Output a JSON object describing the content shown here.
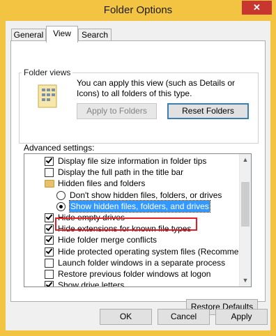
{
  "window": {
    "title": "Folder Options",
    "close_label": "✕"
  },
  "tabs": [
    {
      "label": "General"
    },
    {
      "label": "View"
    },
    {
      "label": "Search"
    }
  ],
  "folder_views": {
    "group_label": "Folder views",
    "description": "You can apply this view (such as Details or Icons) to all folders of this type.",
    "apply_label": "Apply to Folders",
    "reset_label": "Reset Folders"
  },
  "advanced": {
    "label": "Advanced settings:",
    "items": [
      {
        "type": "checkbox",
        "checked": true,
        "indent": 1,
        "label": "Display file size information in folder tips"
      },
      {
        "type": "checkbox",
        "checked": false,
        "indent": 1,
        "label": "Display the full path in the title bar"
      },
      {
        "type": "folder",
        "indent": 1,
        "label": "Hidden files and folders"
      },
      {
        "type": "radio",
        "checked": false,
        "indent": 2,
        "label": "Don't show hidden files, folders, or drives"
      },
      {
        "type": "radio",
        "checked": true,
        "indent": 2,
        "label": "Show hidden files, folders, and drives",
        "selected": true
      },
      {
        "type": "checkbox",
        "checked": true,
        "indent": 1,
        "label": "Hide empty drives"
      },
      {
        "type": "checkbox",
        "checked": true,
        "indent": 1,
        "label": "Hide extensions for known file types"
      },
      {
        "type": "checkbox",
        "checked": true,
        "indent": 1,
        "label": "Hide folder merge conflicts"
      },
      {
        "type": "checkbox",
        "checked": true,
        "indent": 1,
        "label": "Hide protected operating system files (Recommended)"
      },
      {
        "type": "checkbox",
        "checked": false,
        "indent": 1,
        "label": "Launch folder windows in a separate process"
      },
      {
        "type": "checkbox",
        "checked": false,
        "indent": 1,
        "label": "Restore previous folder windows at logon"
      },
      {
        "type": "checkbox",
        "checked": true,
        "indent": 1,
        "label": "Show drive letters"
      }
    ],
    "restore_label": "Restore Defaults"
  },
  "footer": {
    "ok_label": "OK",
    "cancel_label": "Cancel",
    "apply_label": "Apply"
  },
  "colors": {
    "title_bar": "#f3c342",
    "close_button": "#c7372f",
    "selection": "#3399ff",
    "highlight_outline": "#e51c23"
  }
}
